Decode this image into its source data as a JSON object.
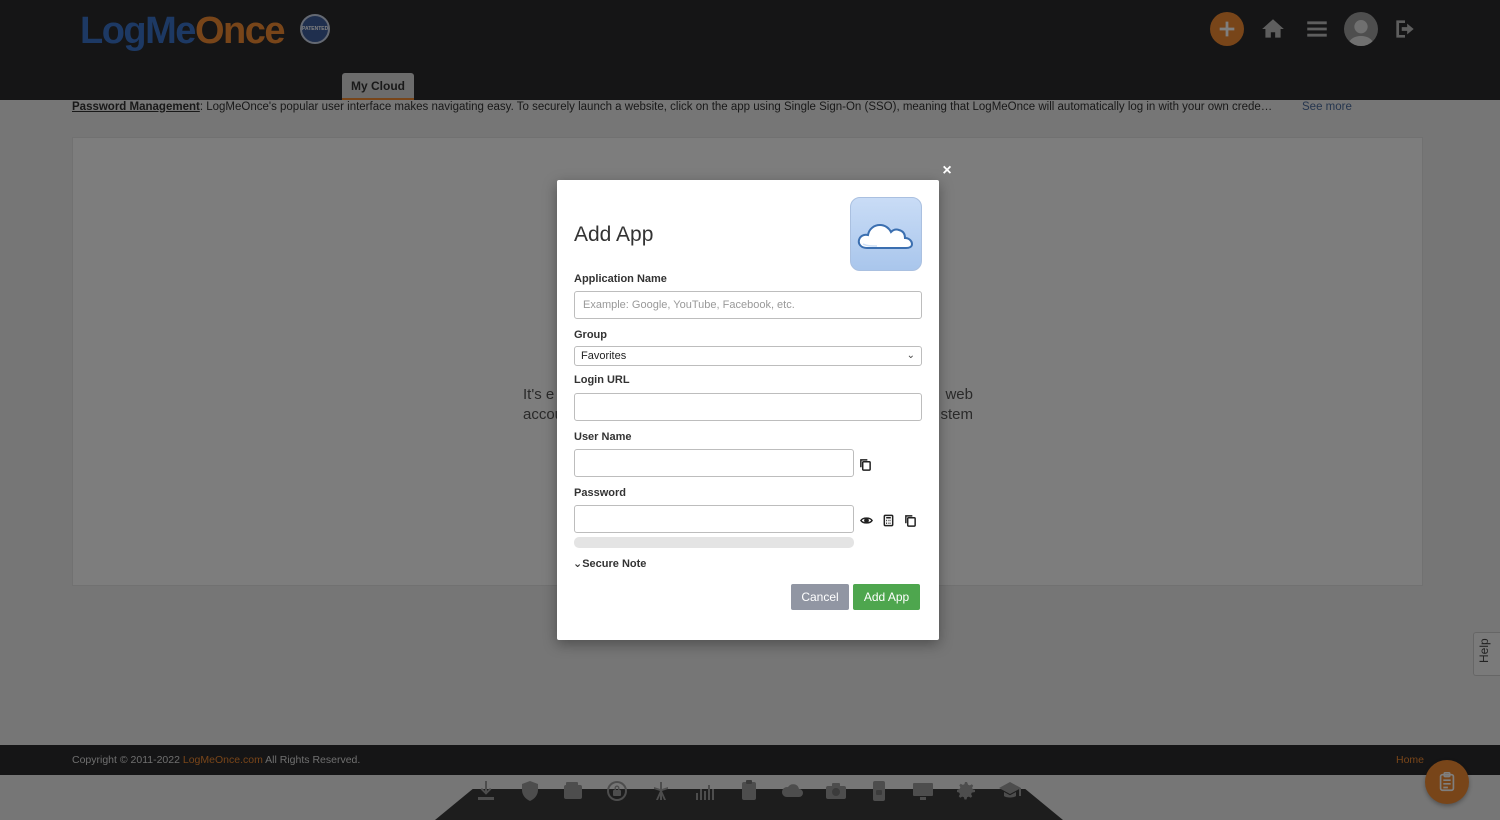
{
  "brand": {
    "logo_part1": "LogMe",
    "logo_part2": "Once",
    "patent_label": "PATENTED",
    "accent_color": "#f08a33",
    "logo_blue": "#3b73c8"
  },
  "header": {
    "icons": [
      "add-icon",
      "home-icon",
      "menu-icon",
      "avatar-icon",
      "logout-icon"
    ]
  },
  "tabs": [
    {
      "label": "My Cloud",
      "active": true
    }
  ],
  "infobar": {
    "lead": "Password Management",
    "text": ": LogMeOnce's popular user interface makes navigating easy. To securely launch a website, click on the app using Single Sign-On (SSO), meaning that LogMeOnce will automatically log in with your own credentials. If you ha...",
    "see_more": "See more"
  },
  "panel": {
    "line1_left": "It's e",
    "line1_right": "web",
    "line2_left": "accou",
    "line2_right": "stem"
  },
  "help_tab": "Help",
  "footer": {
    "copyright_prefix": "Copyright © 2011-2022 ",
    "copyright_link": "LogMeOnce.com",
    "copyright_suffix": " All Rights Reserved.",
    "home_link": "Home"
  },
  "dock": {
    "icons": [
      "download-icon",
      "shield-icon",
      "wallet-icon",
      "lock-circle-icon",
      "tower-icon",
      "stats-icon",
      "clipboard-icon",
      "cloud-user-icon",
      "camera-icon",
      "phone-lock-icon",
      "monitor-icon",
      "gear-icon",
      "graduation-cap-icon"
    ]
  },
  "modal": {
    "close": "×",
    "title": "Add App",
    "application_name": {
      "label": "Application Name",
      "value": "",
      "placeholder": "Example: Google, YouTube, Facebook, etc."
    },
    "group": {
      "label": "Group",
      "selected": "Favorites"
    },
    "login_url": {
      "label": "Login URL",
      "value": ""
    },
    "user_name": {
      "label": "User Name",
      "value": ""
    },
    "password": {
      "label": "Password",
      "value": "",
      "strength": 0
    },
    "secure_note": "Secure Note",
    "cancel_label": "Cancel",
    "add_label": "Add App",
    "add_color": "#4ea64e",
    "cancel_color": "#9196a3"
  }
}
